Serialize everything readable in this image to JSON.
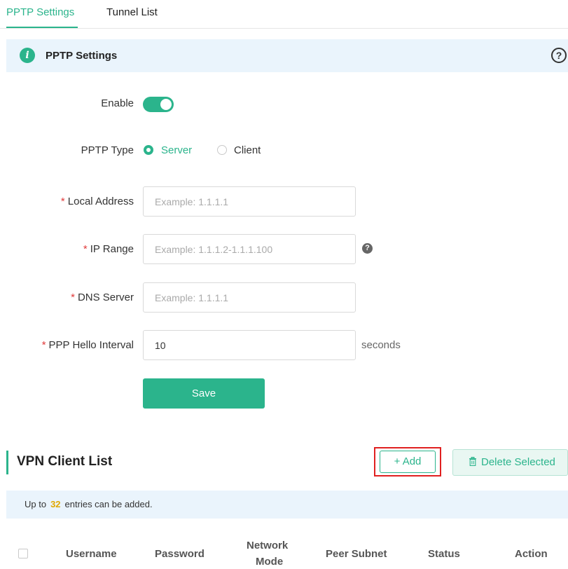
{
  "tabs": [
    {
      "label": "PPTP Settings"
    },
    {
      "label": "Tunnel List"
    }
  ],
  "section": {
    "info_icon": "info-icon",
    "title": "PPTP Settings",
    "help_icon": "?"
  },
  "form": {
    "enable_label": "Enable",
    "enabled": true,
    "type_label": "PPTP Type",
    "type_options": [
      "Server",
      "Client"
    ],
    "type_selected": "Server",
    "required_mark": "*",
    "local_address": {
      "label": "Local Address",
      "placeholder": "Example: 1.1.1.1",
      "value": ""
    },
    "ip_range": {
      "label": "IP Range",
      "placeholder": "Example: 1.1.1.2-1.1.1.100",
      "value": "",
      "help": "?"
    },
    "dns_server": {
      "label": "DNS Server",
      "placeholder": "Example: 1.1.1.1",
      "value": ""
    },
    "hello_interval": {
      "label": "PPP Hello Interval",
      "value": "10",
      "unit": "seconds"
    },
    "save_label": "Save"
  },
  "client_list": {
    "title": "VPN Client List",
    "add_label": "+ Add",
    "delete_icon": "trash-icon",
    "delete_label": "Delete Selected",
    "notice_prefix": "Up to",
    "notice_count": "32",
    "notice_suffix": "entries can be added.",
    "columns": [
      "Username",
      "Password",
      "Network",
      "Mode",
      "Peer Subnet",
      "Status",
      "Action"
    ]
  },
  "colors": {
    "accent": "#2bb48c",
    "banner_bg": "#eaf4fc",
    "highlight_border": "#e02020",
    "required": "#e03b3b"
  }
}
